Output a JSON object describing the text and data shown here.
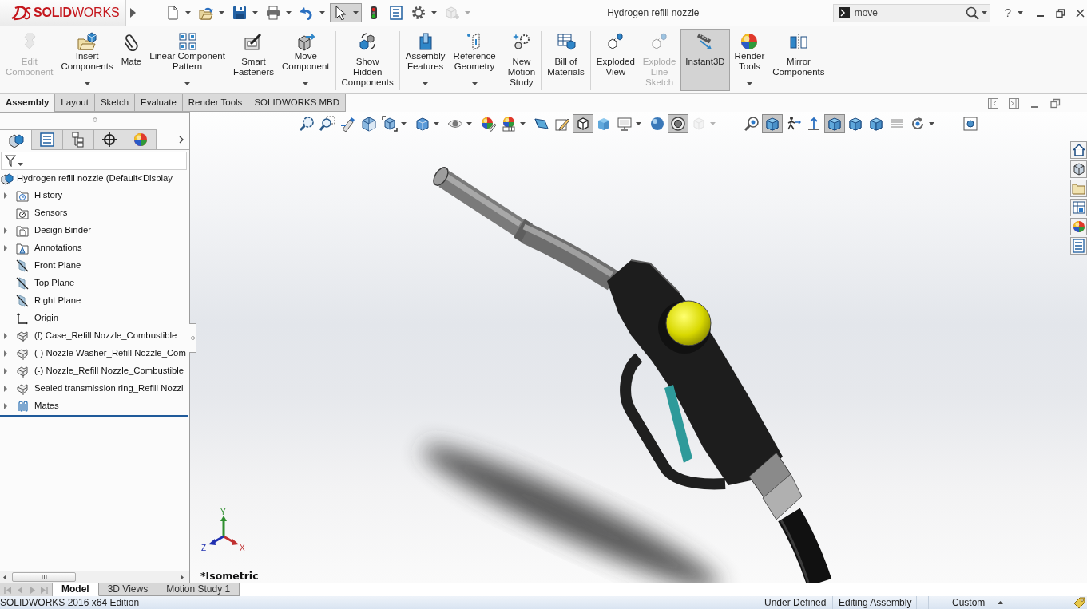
{
  "window": {
    "title": "Hydrogen refill nozzle"
  },
  "logo": {
    "text": "**SOLID**WORKS"
  },
  "quick_access": [
    {
      "kind": "new",
      "dropdown": true,
      "selected": false,
      "disabled": false
    },
    {
      "kind": "open",
      "dropdown": true,
      "selected": false,
      "disabled": false
    },
    {
      "kind": "save",
      "dropdown": true,
      "selected": false,
      "disabled": false
    },
    {
      "kind": "print",
      "dropdown": true,
      "selected": false,
      "disabled": false
    },
    {
      "kind": "undo",
      "dropdown": true,
      "selected": false,
      "disabled": false
    },
    {
      "kind": "select",
      "dropdown": true,
      "selected": true,
      "disabled": false
    },
    {
      "kind": "rebuild",
      "dropdown": false,
      "selected": false,
      "disabled": false
    },
    {
      "kind": "properties",
      "dropdown": false,
      "selected": false,
      "disabled": false
    },
    {
      "kind": "options",
      "dropdown": true,
      "selected": false,
      "disabled": false
    },
    {
      "kind": "addin",
      "dropdown": true,
      "selected": false,
      "disabled": true
    }
  ],
  "search": {
    "value": "move"
  },
  "help": {
    "text": "?"
  },
  "ribbon": [
    {
      "items": [
        {
          "kind": "edit",
          "label": "Edit\nComponent",
          "dropdown": false,
          "selected": false,
          "disabled": true
        },
        {
          "kind": "insert",
          "label": "Insert\nComponents",
          "dropdown": true,
          "selected": false,
          "disabled": false
        },
        {
          "kind": "mate",
          "label": "Mate",
          "dropdown": false,
          "selected": false,
          "disabled": false
        },
        {
          "kind": "pattern",
          "label": "Linear Component\nPattern",
          "dropdown": true,
          "selected": false,
          "disabled": false
        },
        {
          "kind": "fasteners",
          "label": "Smart\nFasteners",
          "dropdown": false,
          "selected": false,
          "disabled": false
        },
        {
          "kind": "move",
          "label": "Move\nComponent",
          "dropdown": true,
          "selected": false,
          "disabled": false
        }
      ]
    },
    {
      "items": [
        {
          "kind": "showhidden",
          "label": "Show\nHidden\nComponents",
          "dropdown": false,
          "selected": false,
          "disabled": false
        }
      ]
    },
    {
      "items": [
        {
          "kind": "features",
          "label": "Assembly\nFeatures",
          "dropdown": true,
          "selected": false,
          "disabled": false
        },
        {
          "kind": "refgeom",
          "label": "Reference\nGeometry",
          "dropdown": true,
          "selected": false,
          "disabled": false
        }
      ]
    },
    {
      "items": [
        {
          "kind": "motion",
          "label": "New\nMotion\nStudy",
          "dropdown": false,
          "selected": false,
          "disabled": false
        }
      ]
    },
    {
      "items": [
        {
          "kind": "bom",
          "label": "Bill of\nMaterials",
          "dropdown": false,
          "selected": false,
          "disabled": false
        }
      ]
    },
    {
      "items": [
        {
          "kind": "exploded",
          "label": "Exploded\nView",
          "dropdown": false,
          "selected": false,
          "disabled": false
        },
        {
          "kind": "explodeline",
          "label": "Explode\nLine\nSketch",
          "dropdown": false,
          "selected": false,
          "disabled": true
        },
        {
          "kind": "instant3d",
          "label": "Instant3D",
          "dropdown": false,
          "selected": true,
          "disabled": false
        },
        {
          "kind": "render",
          "label": "Render\nTools",
          "dropdown": true,
          "selected": false,
          "disabled": false
        },
        {
          "kind": "mirror",
          "label": "Mirror\nComponents",
          "dropdown": false,
          "selected": false,
          "disabled": false
        }
      ]
    }
  ],
  "command_tabs": [
    {
      "label": "Assembly",
      "selected": true
    },
    {
      "label": "Layout",
      "selected": false
    },
    {
      "label": "Sketch",
      "selected": false
    },
    {
      "label": "Evaluate",
      "selected": false
    },
    {
      "label": "Render Tools",
      "selected": false
    },
    {
      "label": "SOLIDWORKS MBD",
      "selected": false
    }
  ],
  "panel_tabs": [
    {
      "kind": "features",
      "selected": true
    },
    {
      "kind": "properties",
      "selected": false
    },
    {
      "kind": "configurations",
      "selected": false
    },
    {
      "kind": "dimxpert",
      "selected": false
    },
    {
      "kind": "display",
      "selected": false
    }
  ],
  "tree": {
    "kind": "assembly",
    "label": "Hydrogen refill nozzle (Default<Display",
    "children": [
      {
        "kind": "history",
        "label": "History",
        "expanded": false
      },
      {
        "kind": "sensors",
        "label": "Sensors"
      },
      {
        "kind": "binder",
        "label": "Design Binder",
        "expanded": false
      },
      {
        "kind": "annotations",
        "label": "Annotations",
        "expanded": false
      },
      {
        "kind": "plane",
        "label": "Front Plane"
      },
      {
        "kind": "plane",
        "label": "Top Plane"
      },
      {
        "kind": "plane",
        "label": "Right Plane"
      },
      {
        "kind": "origin",
        "label": "Origin"
      },
      {
        "kind": "part",
        "label": "(f) Case_Refill Nozzle_Combustible",
        "expanded": false
      },
      {
        "kind": "part",
        "label": "(-) Nozzle Washer_Refill Nozzle_Com",
        "expanded": false
      },
      {
        "kind": "part",
        "label": "(-) Nozzle_Refill Nozzle_Combustible",
        "expanded": false
      },
      {
        "kind": "part",
        "label": "Sealed transmission ring_Refill Nozzl",
        "expanded": false
      },
      {
        "kind": "mates",
        "label": "Mates",
        "expanded": false
      }
    ]
  },
  "view_toolbar": [
    {
      "items": [
        {
          "kind": "zoomfit",
          "dropdown": false,
          "selected": false,
          "disabled": false
        },
        {
          "kind": "zoomarea",
          "dropdown": false,
          "selected": false,
          "disabled": false
        },
        {
          "kind": "previous",
          "dropdown": false,
          "selected": false,
          "disabled": false
        },
        {
          "kind": "section",
          "dropdown": false,
          "selected": false,
          "disabled": false
        },
        {
          "kind": "orientation",
          "dropdown": true,
          "selected": false,
          "disabled": false
        },
        {
          "kind": "display",
          "dropdown": true,
          "selected": false,
          "disabled": false
        },
        {
          "kind": "hide",
          "dropdown": true,
          "selected": false,
          "disabled": false
        },
        {
          "kind": "appearance",
          "dropdown": false,
          "selected": false,
          "disabled": false
        },
        {
          "kind": "scene",
          "dropdown": true,
          "selected": false,
          "disabled": false
        },
        {
          "kind": "wedge",
          "dropdown": false,
          "selected": false,
          "disabled": false
        },
        {
          "kind": "sketchbox",
          "dropdown": false,
          "selected": false,
          "disabled": false
        },
        {
          "kind": "wireframe",
          "dropdown": false,
          "selected": true,
          "disabled": false
        },
        {
          "kind": "shaded",
          "dropdown": false,
          "selected": false,
          "disabled": false
        },
        {
          "kind": "monitor",
          "dropdown": true,
          "selected": false,
          "disabled": false
        },
        {
          "kind": "realview",
          "dropdown": false,
          "selected": false,
          "disabled": false
        },
        {
          "kind": "occlusion",
          "dropdown": false,
          "selected": true,
          "disabled": false
        },
        {
          "kind": "ghost",
          "dropdown": true,
          "selected": false,
          "disabled": true
        }
      ]
    },
    {
      "items": [
        {
          "kind": "zoomring",
          "dropdown": false,
          "selected": false,
          "disabled": false
        },
        {
          "kind": "cube",
          "dropdown": false,
          "selected": true,
          "disabled": false
        },
        {
          "kind": "walk",
          "dropdown": false,
          "selected": false,
          "disabled": false
        },
        {
          "kind": "axis",
          "dropdown": false,
          "selected": false,
          "disabled": false
        },
        {
          "kind": "cube",
          "dropdown": false,
          "selected": true,
          "disabled": false
        },
        {
          "kind": "cube",
          "dropdown": false,
          "selected": false,
          "disabled": false
        },
        {
          "kind": "cube",
          "dropdown": false,
          "selected": false,
          "disabled": false
        },
        {
          "kind": "lines",
          "dropdown": false,
          "selected": false,
          "disabled": false
        },
        {
          "kind": "rotate",
          "dropdown": true,
          "selected": false,
          "disabled": false
        }
      ]
    },
    {
      "items": [
        {
          "kind": "screen",
          "dropdown": false,
          "selected": false,
          "disabled": false
        }
      ]
    }
  ],
  "task_pane": [
    {
      "kind": "home"
    },
    {
      "kind": "library"
    },
    {
      "kind": "explorer"
    },
    {
      "kind": "palette"
    },
    {
      "kind": "appearances"
    },
    {
      "kind": "properties"
    }
  ],
  "triad": {
    "y": "Y",
    "z": "Z",
    "x": "X"
  },
  "view_name": "*Isometric",
  "bottom_tabs": [
    {
      "label": "Model",
      "selected": true
    },
    {
      "label": "3D Views",
      "selected": false
    },
    {
      "label": "Motion Study 1",
      "selected": false
    }
  ],
  "status_bar": {
    "product": "SOLIDWORKS 2016 x64 Edition",
    "definition": "Under Defined",
    "mode": "Editing Assembly",
    "units": "Custom"
  }
}
